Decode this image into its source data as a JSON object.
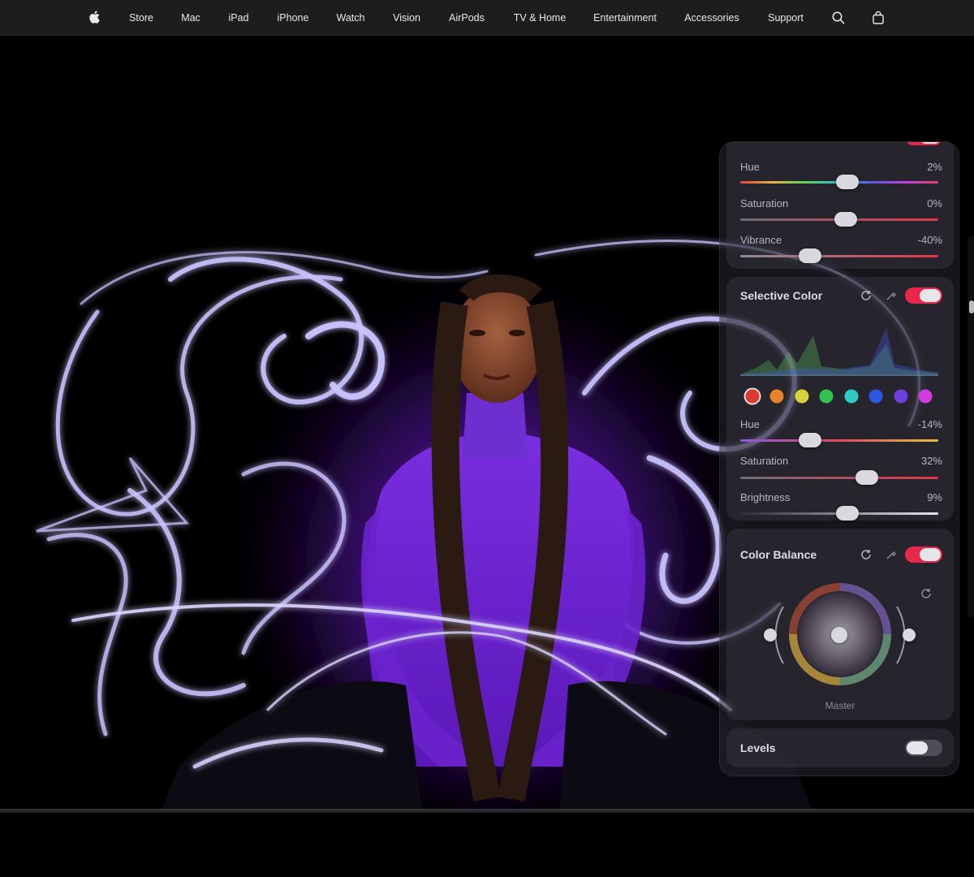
{
  "nav": {
    "apple_logo": "apple-logo-icon",
    "items": [
      "Store",
      "Mac",
      "iPad",
      "iPhone",
      "Watch",
      "Vision",
      "AirPods",
      "TV & Home",
      "Entertainment",
      "Accessories",
      "Support"
    ],
    "search_icon": "search-icon",
    "bag_icon": "shopping-bag-icon"
  },
  "panel": {
    "adjust": {
      "rows": [
        {
          "label": "Hue",
          "value": "2%"
        },
        {
          "label": "Saturation",
          "value": "0%"
        },
        {
          "label": "Vibrance",
          "value": "-40%"
        }
      ]
    },
    "selective_color": {
      "title": "Selective Color",
      "swatches": [
        "#e0372f",
        "#e8832a",
        "#d6d339",
        "#2fc24e",
        "#2fc8c3",
        "#2b57e0",
        "#6c40e0",
        "#d43be0"
      ],
      "rows": [
        {
          "label": "Hue",
          "value": "-14%"
        },
        {
          "label": "Saturation",
          "value": "32%"
        },
        {
          "label": "Brightness",
          "value": "9%"
        }
      ]
    },
    "color_balance": {
      "title": "Color Balance",
      "wheel_label": "Master"
    },
    "levels": {
      "title": "Levels"
    }
  },
  "colors": {
    "nav_bg": "#1d1d1f",
    "accent_toggle": "#e8284a",
    "garment": "#7a2ee0",
    "chrome": "#c9c3ff"
  }
}
